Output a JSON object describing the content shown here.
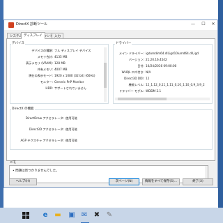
{
  "window": {
    "title": "DirectX 診断ツール",
    "buttons": {
      "minimize": "—",
      "maximize": "☐",
      "close": "✕"
    }
  },
  "tabs": [
    "システム",
    "ディスプレイ",
    "サウンド",
    "入力"
  ],
  "active_tab": "ディスプレイ",
  "device": {
    "heading": "デバイス",
    "rows": [
      {
        "key": "デバイスの種類:",
        "value": "フル ディスプレイ デバイス"
      },
      {
        "key": "メモリ合計:",
        "value": "4135 MB"
      },
      {
        "key": "表示メモリ (VRAM):",
        "value": "128 MB"
      },
      {
        "key": "共有メモリ:",
        "value": "4007 MB"
      },
      {
        "key": "現在の表示モード:",
        "value": "1920 x 1080 (32 bit) (60Hz)"
      },
      {
        "key": "モニター:",
        "value": "Generic PnP Monitor"
      },
      {
        "key": "HDR:",
        "value": "サポートされていません"
      }
    ]
  },
  "drivers": {
    "heading": "ドライバー",
    "rows": [
      {
        "key": "メイン ドライバー:",
        "value": "igdumdim64.dll,igd10iumd64.dll,igd"
      },
      {
        "key": "バージョン:",
        "value": "21.20.16.4542"
      },
      {
        "key": "日付:",
        "value": "10/24/2016 09:00:00"
      },
      {
        "key": "WHQL ロゴ付き:",
        "value": "N/A"
      },
      {
        "key": "Direct3D DDI:",
        "value": "12"
      },
      {
        "key": "機能レベル:",
        "value": "12_1,12_0,11_1,11_0,10_1,10_0,9_3,9_2"
      },
      {
        "key": "ドライバー モデル:",
        "value": "WDDM 2.1"
      }
    ]
  },
  "directx_features": {
    "heading": "DirectX の機能",
    "rows": [
      {
        "key": "DirectDraw アクセラレータ:",
        "value": "使用可能"
      },
      {
        "key": "Direct3D アクセラレータ:",
        "value": "使用可能"
      },
      {
        "key": "AGP テクスチャ アクセラレータ:",
        "value": "使用可能"
      }
    ]
  },
  "notes": {
    "heading": "メモ",
    "items": [
      "問題は見つかりませんでした。"
    ]
  },
  "footer": {
    "help": "ヘルプ(H)",
    "next_page": "次ページ(N)",
    "save_all": "情報をすべて保存(S)...",
    "exit": "終了(X)"
  },
  "taskbar": {
    "icons": [
      "start-icon",
      "edge-icon",
      "file-explorer-icon",
      "store-icon",
      "mail-icon",
      "directx-icon",
      "paint-icon"
    ]
  },
  "colors": {
    "accent": "#0078d7",
    "desktop": "#3f6fae"
  }
}
